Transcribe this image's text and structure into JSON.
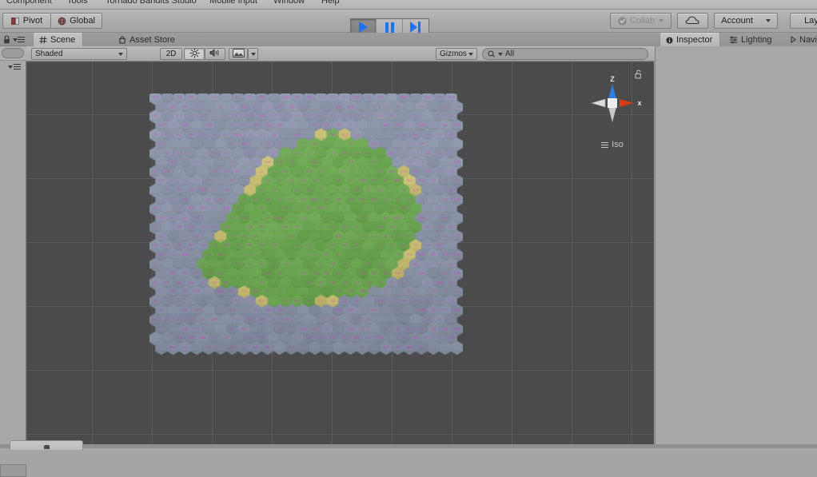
{
  "menubar": {
    "items": [
      "Component",
      "Tools",
      "Tornado Bandits Studio",
      "Mobile Input",
      "Window",
      "Help"
    ]
  },
  "toolbar": {
    "pivot_label": "Pivot",
    "pivot_icon": "pivot-icon",
    "global_label": "Global",
    "global_icon": "globe-icon",
    "play_icon": "play-icon",
    "pause_icon": "pause-icon",
    "step_icon": "step-icon",
    "collab_label": "Collab",
    "collab_icon": "collab-check-icon",
    "cloud_icon": "cloud-icon",
    "account_label": "Account",
    "layers_label": "Laye"
  },
  "hierarchy": {
    "lock_icon": "lock-icon",
    "menu_icon": "hamburger-menu-icon",
    "dropdown_icon": "chevron-down-icon"
  },
  "scene": {
    "tabs": [
      {
        "label": "Scene",
        "icon": "grid-hash-icon",
        "active": true
      },
      {
        "label": "Asset Store",
        "icon": "store-bag-icon",
        "active": false
      }
    ],
    "toolbar": {
      "shading_mode": "Shaded",
      "mode_2d": "2D",
      "light_icon": "sun-icon",
      "audio_icon": "speaker-icon",
      "fx_icon": "image-fx-icon",
      "fx_dropdown_icon": "chevron-down-icon",
      "gizmos_label": "Gizmos",
      "search_icon": "search-icon",
      "search_value": "All",
      "search_placeholder": "All"
    },
    "gizmo": {
      "axis_z_label": "Z",
      "axis_x_label": "x",
      "projection_label": "Iso",
      "lock_icon": "lock-open-icon",
      "menu_icon": "hamburger-menu-icon",
      "color_z": "#2d7fe8",
      "color_x": "#e03a14",
      "color_neutral": "#d2d2d2",
      "color_center": "#ededed"
    },
    "viewport": {
      "background_color": "#4b4b4b",
      "grid_color": "rgba(255,255,255,0.09)"
    }
  },
  "terrain": {
    "description": "Hexagonal tile map island with coordinate labels",
    "colors": {
      "water": "#8a93a8",
      "grass": "#6aa84f",
      "sand": "#c9c070",
      "label": "#e628d8",
      "edge_shadow": "#565b66"
    },
    "hex_cols": 26,
    "hex_rows": 28,
    "label_font_size": 3.2
  },
  "inspector": {
    "tabs": [
      {
        "label": "Inspector",
        "icon": "info-circle-icon",
        "active": true
      },
      {
        "label": "Lighting",
        "icon": "lighting-sliders-icon",
        "active": false
      },
      {
        "label": "Navig",
        "icon": "navigation-icon",
        "active": false
      }
    ]
  }
}
